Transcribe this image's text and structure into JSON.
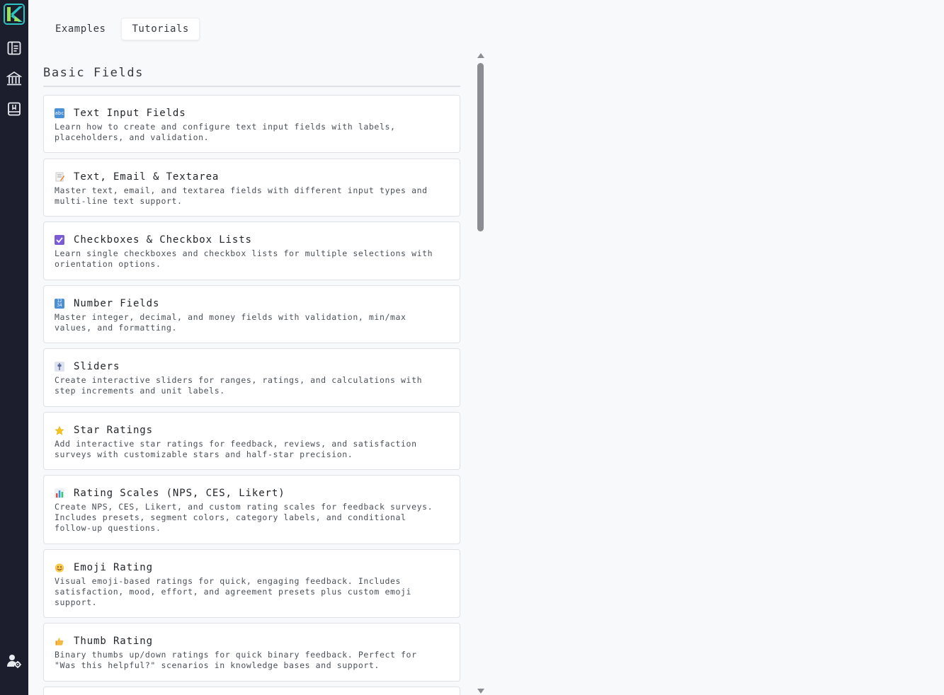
{
  "sidebar": {
    "logo": "app-logo",
    "items": [
      {
        "icon": "forms-icon"
      },
      {
        "icon": "library-icon"
      },
      {
        "icon": "book-icon"
      }
    ],
    "bottom_icon": "user-settings-icon"
  },
  "tabs": [
    {
      "label": "Examples",
      "active": false
    },
    {
      "label": "Tutorials",
      "active": true
    }
  ],
  "section": {
    "title": "Basic Fields"
  },
  "cards": [
    {
      "icon": "abc-icon",
      "title": "Text Input Fields",
      "description": "Learn how to create and configure text input fields with labels, placeholders, and validation."
    },
    {
      "icon": "memo-icon",
      "title": "Text, Email & Textarea",
      "description": "Master text, email, and textarea fields with different input types and multi-line text support."
    },
    {
      "icon": "checkbox-icon",
      "title": "Checkboxes & Checkbox Lists",
      "description": "Learn single checkboxes and checkbox lists for multiple selections with orientation options."
    },
    {
      "icon": "numbers-icon",
      "title": "Number Fields",
      "description": "Master integer, decimal, and money fields with validation, min/max values, and formatting."
    },
    {
      "icon": "slider-icon",
      "title": "Sliders",
      "description": "Create interactive sliders for ranges, ratings, and calculations with step increments and unit labels."
    },
    {
      "icon": "star-icon",
      "title": "Star Ratings",
      "description": "Add interactive star ratings for feedback, reviews, and satisfaction surveys with customizable stars and half-star precision."
    },
    {
      "icon": "bar-chart-icon",
      "title": "Rating Scales (NPS, CES, Likert)",
      "description": "Create NPS, CES, Likert, and custom rating scales for feedback surveys. Includes presets, segment colors, category labels, and conditional follow-up questions."
    },
    {
      "icon": "smiley-icon",
      "title": "Emoji Rating",
      "description": "Visual emoji-based ratings for quick, engaging feedback. Includes satisfaction, mood, effort, and agreement presets plus custom emoji support."
    },
    {
      "icon": "thumbs-up-icon",
      "title": "Thumb Rating",
      "description": "Binary thumbs up/down ratings for quick binary feedback. Perfect for \"Was this helpful?\" scenarios in knowledge bases and support."
    }
  ],
  "colors": {
    "sidebar_bg": "#1c1e2e",
    "accent": "#2ec4c4",
    "page_bg": "#f8f9fa"
  }
}
